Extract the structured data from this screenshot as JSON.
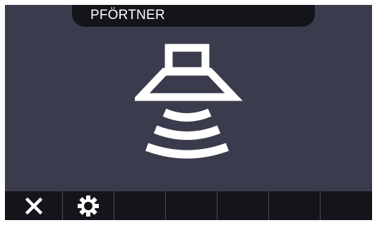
{
  "header": {
    "title": "PFÖRTNER"
  },
  "main": {
    "icon": "doorkeeper-speaker-icon"
  },
  "toolbar": {
    "buttons": [
      {
        "icon": "close-icon"
      },
      {
        "icon": "gear-icon"
      },
      {
        "icon": ""
      },
      {
        "icon": ""
      },
      {
        "icon": ""
      },
      {
        "icon": ""
      },
      {
        "icon": ""
      }
    ]
  },
  "colors": {
    "background": "#3a3b4d",
    "bars": "#14141b",
    "foreground": "#ffffff"
  }
}
